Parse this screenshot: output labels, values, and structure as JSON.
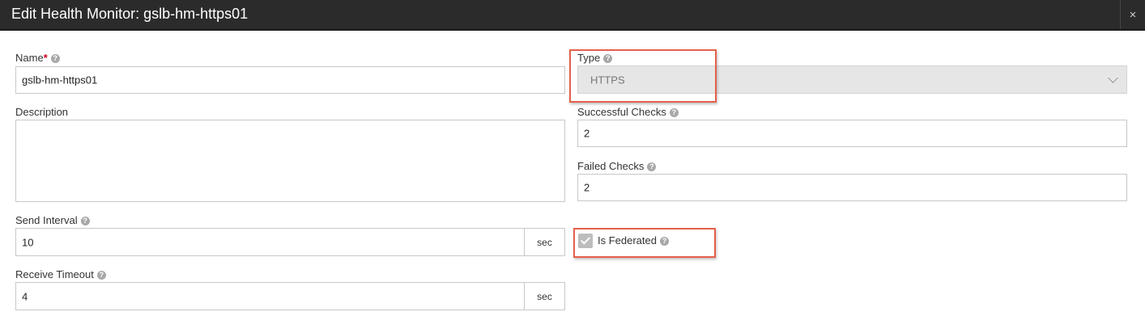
{
  "dialog": {
    "title": "Edit Health Monitor: gslb-hm-https01",
    "close_glyph": "×"
  },
  "fields": {
    "name": {
      "label": "Name",
      "required_mark": "*",
      "value": "gslb-hm-https01"
    },
    "description": {
      "label": "Description",
      "value": ""
    },
    "send_interval": {
      "label": "Send Interval",
      "value": "10",
      "unit": "sec"
    },
    "receive_timeout": {
      "label": "Receive Timeout",
      "value": "4",
      "unit": "sec"
    },
    "type": {
      "label": "Type",
      "value": "HTTPS"
    },
    "successful_checks": {
      "label": "Successful Checks",
      "value": "2"
    },
    "failed_checks": {
      "label": "Failed Checks",
      "value": "2"
    },
    "is_federated": {
      "label": "Is Federated",
      "checked": true
    }
  },
  "help_glyph": "?",
  "colors": {
    "titlebar": "#2b2b2b",
    "highlight": "#e5604a",
    "required": "#d0021b"
  }
}
